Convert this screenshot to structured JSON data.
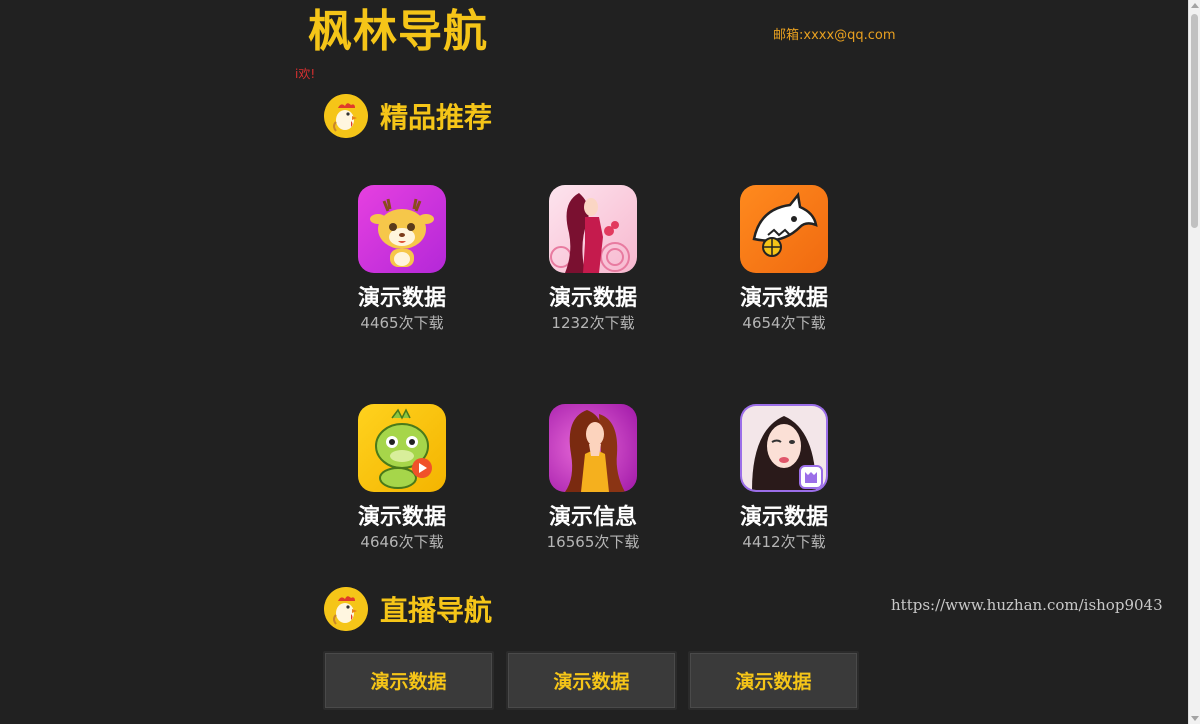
{
  "header": {
    "site_title": "枫林导航",
    "email": "邮箱:xxxx@qq.com",
    "marquee": "i欢!"
  },
  "sections": {
    "featured": {
      "title": "精品推荐",
      "icon": "rooster-icon"
    },
    "live": {
      "title": "直播导航",
      "icon": "rooster-icon"
    }
  },
  "apps": [
    {
      "name": "演示数据",
      "downloads": "4465次下载",
      "icon": "deer-cartoon-icon"
    },
    {
      "name": "演示数据",
      "downloads": "1232次下载",
      "icon": "woman-silhouette-icon"
    },
    {
      "name": "演示数据",
      "downloads": "4654次下载",
      "icon": "shark-icon"
    },
    {
      "name": "演示数据",
      "downloads": "4646次下载",
      "icon": "dragon-cartoon-icon"
    },
    {
      "name": "演示信息",
      "downloads": "16565次下载",
      "icon": "woman-portrait-icon"
    },
    {
      "name": "演示数据",
      "downloads": "4412次下载",
      "icon": "girl-photo-icon"
    }
  ],
  "live_links": [
    {
      "label": "演示数据"
    },
    {
      "label": "演示数据"
    },
    {
      "label": "演示数据"
    }
  ],
  "watermark": "https://www.huzhan.com/ishop9043",
  "colors": {
    "background": "#212121",
    "accent": "#f5c518",
    "email": "#e8a020",
    "marquee": "#d93030"
  }
}
